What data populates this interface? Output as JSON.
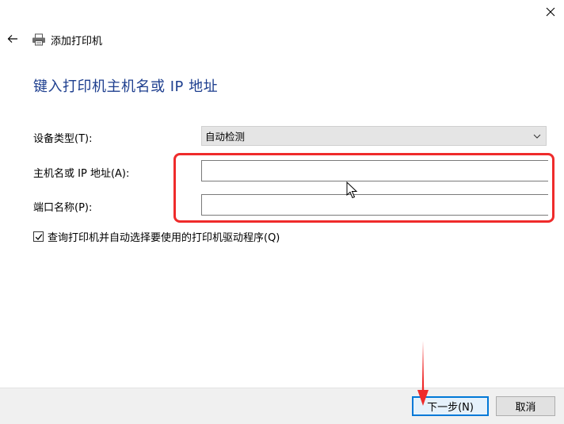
{
  "window": {
    "title": "添加打印机",
    "heading": "键入打印机主机名或 IP 地址"
  },
  "form": {
    "device_type_label": "设备类型(T):",
    "device_type_value": "自动检测",
    "hostname_label": "主机名或 IP 地址(A):",
    "hostname_value": "",
    "port_label": "端口名称(P):",
    "port_value": "",
    "query_checkbox_label": "查询打印机并自动选择要使用的打印机驱动程序(Q)",
    "query_checkbox_checked": true
  },
  "footer": {
    "next_label": "下一步(N)",
    "cancel_label": "取消"
  },
  "icons": {
    "close": "close-icon",
    "back": "back-arrow-icon",
    "printer": "printer-icon",
    "chevron": "chevron-down-icon",
    "check": "checkmark-icon",
    "cursor": "mouse-cursor-icon"
  },
  "colors": {
    "heading": "#1e3f8f",
    "annotation": "#ef2b2b",
    "primary_border": "#0078d7"
  }
}
